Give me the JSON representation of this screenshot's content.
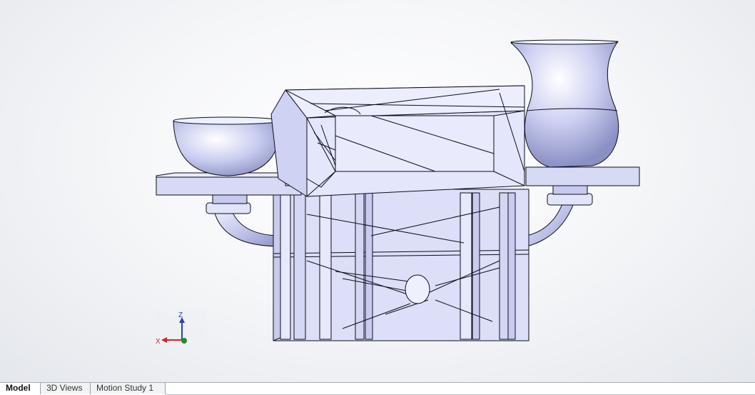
{
  "tabs": [
    {
      "label": "Model",
      "active": true
    },
    {
      "label": "3D Views",
      "active": false
    },
    {
      "label": "Motion Study 1",
      "active": false
    }
  ],
  "triad": {
    "z_label": "Z",
    "x_label": "X"
  },
  "colors": {
    "part_face": "#d6d9f2",
    "part_edge": "#0b0d1a",
    "axis_x": "#d2232a",
    "axis_z": "#2a3fb0",
    "axis_y": "#1e8c2e"
  }
}
